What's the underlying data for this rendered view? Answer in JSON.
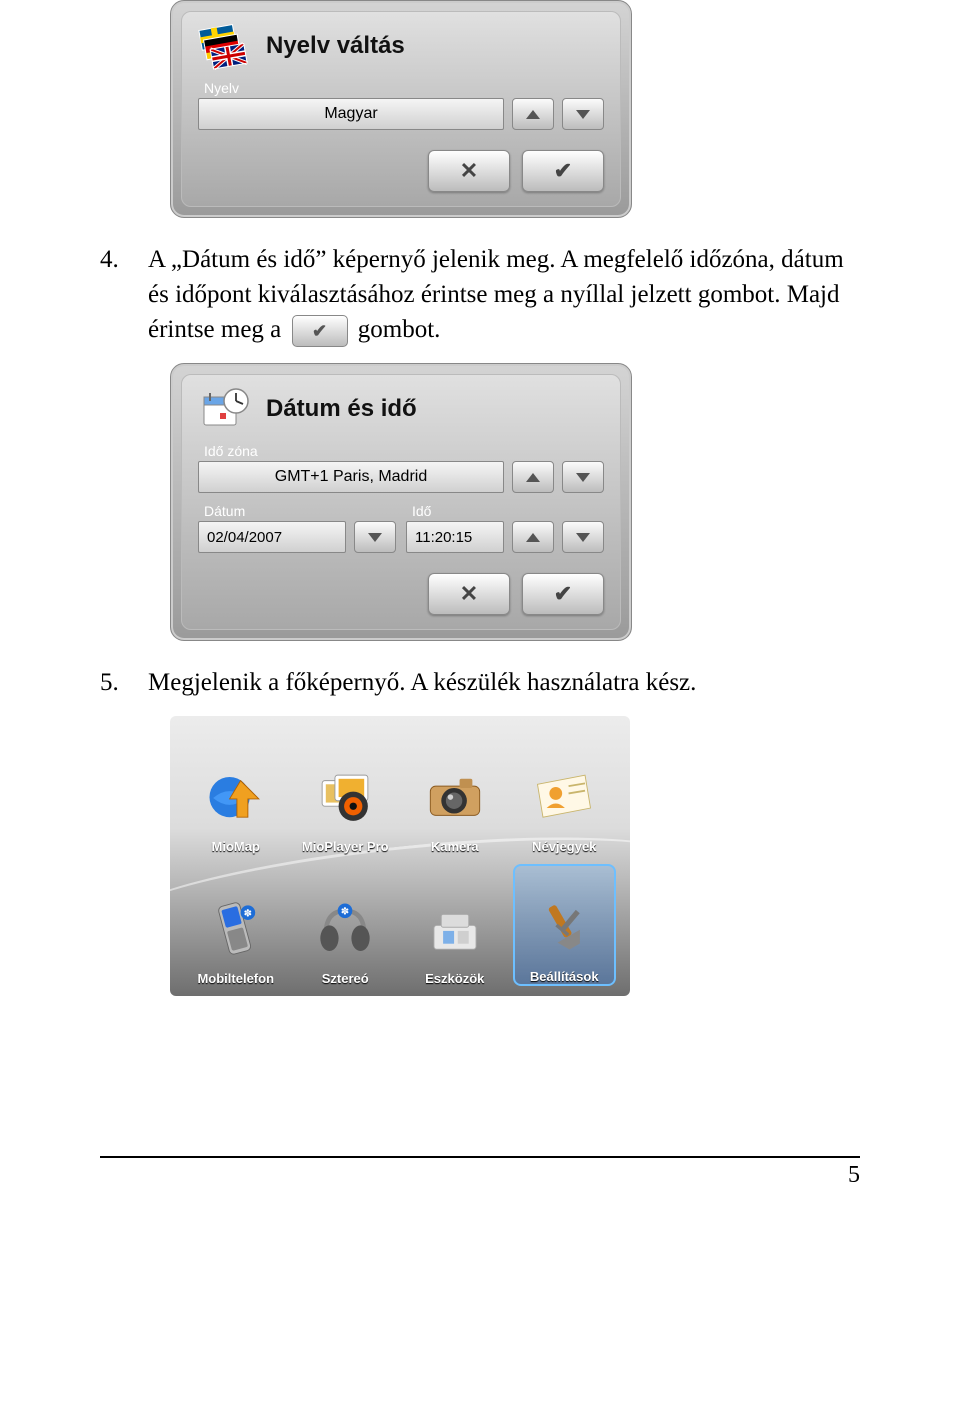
{
  "page_number": "5",
  "dialog1": {
    "title": "Nyelv váltás",
    "field_label": "Nyelv",
    "value": "Magyar"
  },
  "step4_num": "4.",
  "step4_text_before": "A „Dátum és idő” képernyő jelenik meg. A megfelelő időzóna, dátum és időpont kiválasztásához érintse meg a nyíllal jelzett gombot. Majd érintse meg a",
  "step4_text_after": "gombot.",
  "dialog2": {
    "title": "Dátum és idő",
    "tz_label": "Idő zóna",
    "tz_value": "GMT+1 Paris, Madrid",
    "date_label": "Dátum",
    "date_value": "02/04/2007",
    "time_label": "Idő",
    "time_value": "11:20:15"
  },
  "step5_num": "5.",
  "step5_text": "Megjelenik a főképernyő. A készülék használatra kész.",
  "apps": {
    "miomap": "MioMap",
    "mioplayer": "MioPlayer Pro",
    "kamera": "Kamera",
    "nevjegyek": "Névjegyek",
    "mobil": "Mobiltelefon",
    "sztereo": "Sztereó",
    "eszkozok": "Eszközök",
    "beallitasok": "Beállítások"
  }
}
